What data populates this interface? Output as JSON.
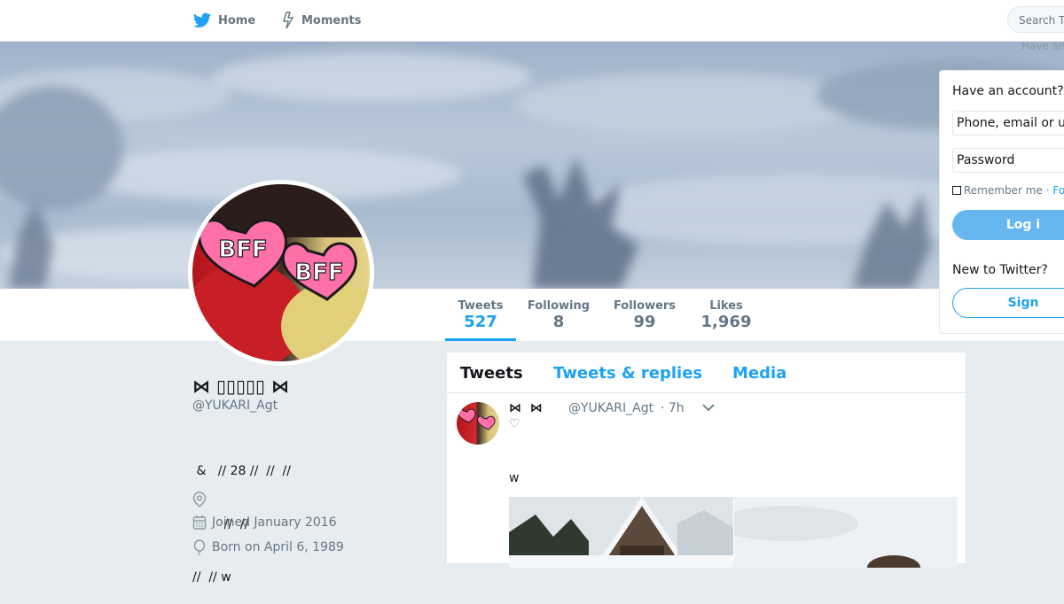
{
  "nav": {
    "home_label": "Home",
    "moments_label": "Moments",
    "search_placeholder": "Search T",
    "have_account_hint": "Have an"
  },
  "profile": {
    "name": "⋈ ▯▯▯▯▯ ⋈",
    "handle": "@YUKARI_Agt",
    "bio_lines": [
      " &   // 28 //  //  //",
      "        //  //",
      "//  // w"
    ],
    "location": "",
    "joined": "Joined January 2016",
    "born": "Born on April 6, 1989"
  },
  "stats": [
    {
      "label": "Tweets",
      "value": "527"
    },
    {
      "label": "Following",
      "value": "8"
    },
    {
      "label": "Followers",
      "value": "99"
    },
    {
      "label": "Likes",
      "value": "1,969"
    }
  ],
  "timeline": {
    "tabs": [
      "Tweets",
      "Tweets & replies",
      "Media"
    ],
    "tweet": {
      "name": "⋈  ⋈",
      "handle": "@YUKARI_Agt",
      "time": "· 7h",
      "heart": "♡",
      "text": "w"
    }
  },
  "login": {
    "title": "Have an account?",
    "username_placeholder": "Phone, email or u",
    "password_placeholder": "Password",
    "remember": "Remember me",
    "forgot": "· Fo",
    "login_button": "Log i",
    "new_title": "New to Twitter?",
    "signup_button": "Sign"
  },
  "colors": {
    "accent": "#1da1f2",
    "background": "#e6ecf0"
  },
  "icons": {
    "home": "twitter-bird-icon",
    "moments": "lightning-icon",
    "location": "location-pin-icon",
    "joined": "calendar-icon",
    "born": "balloon-icon",
    "caret": "chevron-down-icon"
  }
}
